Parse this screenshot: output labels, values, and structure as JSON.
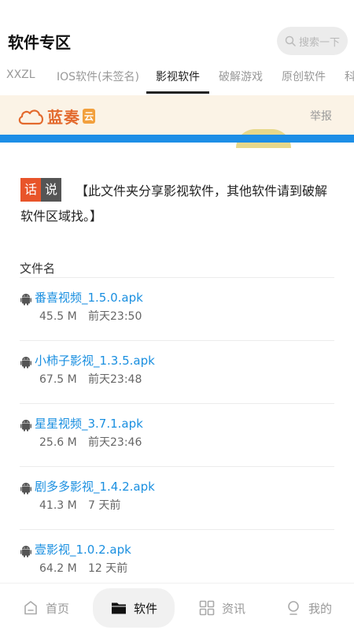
{
  "header": {
    "title": "软件专区",
    "search_placeholder": "搜索一下"
  },
  "tabs": [
    {
      "label": "XXZL",
      "active": false
    },
    {
      "label": "IOS软件(未签名)",
      "active": false
    },
    {
      "label": "影视软件",
      "active": true
    },
    {
      "label": "破解游戏",
      "active": false
    },
    {
      "label": "原创软件",
      "active": false
    },
    {
      "label": "科",
      "active": false
    }
  ],
  "banner": {
    "brand": "蓝奏",
    "badge": "云",
    "report": "举报"
  },
  "notice": {
    "tag1": "话",
    "tag2": "说",
    "line1": "【此文件夹分享影视软件，其他软件请到破解",
    "line2": "软件区域找。】"
  },
  "file_list": {
    "column_header": "文件名",
    "files": [
      {
        "name": "番喜视频_1.5.0.apk",
        "size": "45.5 M",
        "time": "前天23:50"
      },
      {
        "name": "小柿子影视_1.3.5.apk",
        "size": "67.5 M",
        "time": "前天23:48"
      },
      {
        "name": "星星视频_3.7.1.apk",
        "size": "25.6 M",
        "time": "前天23:46"
      },
      {
        "name": "剧多多影视_1.4.2.apk",
        "size": "41.3 M",
        "time": "7 天前"
      },
      {
        "name": "壹影视_1.0.2.apk",
        "size": "64.2 M",
        "time": "12 天前"
      }
    ]
  },
  "bottom_nav": [
    {
      "label": "首页",
      "icon": "home-icon",
      "active": false
    },
    {
      "label": "软件",
      "icon": "folder-icon",
      "active": true
    },
    {
      "label": "资讯",
      "icon": "grid-icon",
      "active": false
    },
    {
      "label": "我的",
      "icon": "user-icon",
      "active": false
    }
  ],
  "colors": {
    "accent_link": "#1a8fe0",
    "tag_red": "#e8542a",
    "tag_dark": "#555555",
    "brand_orange": "#e36a2e",
    "banner_bg": "#fbf3e6"
  }
}
